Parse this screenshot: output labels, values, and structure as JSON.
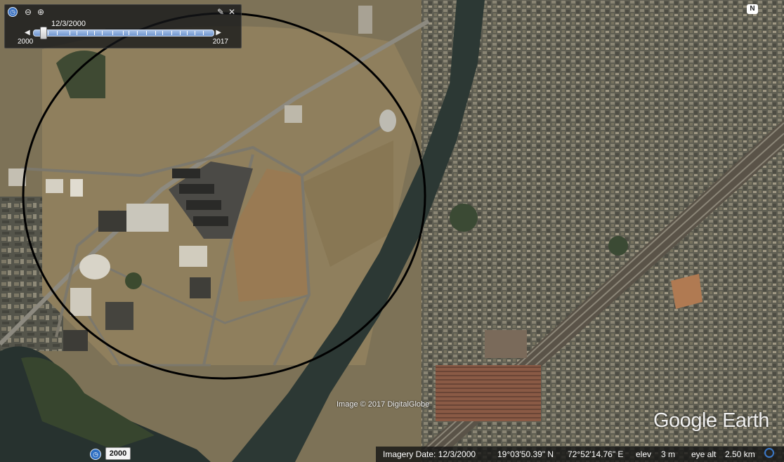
{
  "app": "Google Earth",
  "time_slider": {
    "current_date": "12/3/2000",
    "start_year": "2000",
    "end_year": "2017",
    "position": 0.04
  },
  "compass": {
    "label": "N"
  },
  "map": {
    "credit": "Image © 2017 DigitalGlobe",
    "logo": "Google Earth",
    "overlay_circle_color": "#000000"
  },
  "historical_imagery": {
    "year": "2000"
  },
  "status_bar": {
    "imagery_date": "Imagery Date: 12/3/2000",
    "latitude": "19°03'50.39\" N",
    "longitude": "72°52'14.76\" E",
    "elev_label": "elev",
    "elevation": "3 m",
    "eye_alt_label": "eye alt",
    "eye_alt": "2.50 km"
  },
  "icons": {
    "clock": "clock-icon",
    "zoom_out": "zoom-out-icon",
    "zoom_in": "zoom-in-icon",
    "settings": "wrench-icon",
    "close": "close-icon",
    "north": "north-arrow-icon"
  },
  "colors": {
    "water": "#2e3a36",
    "land": "#8a7a58",
    "urban": "#6c6a5c",
    "panel": "#141618"
  }
}
